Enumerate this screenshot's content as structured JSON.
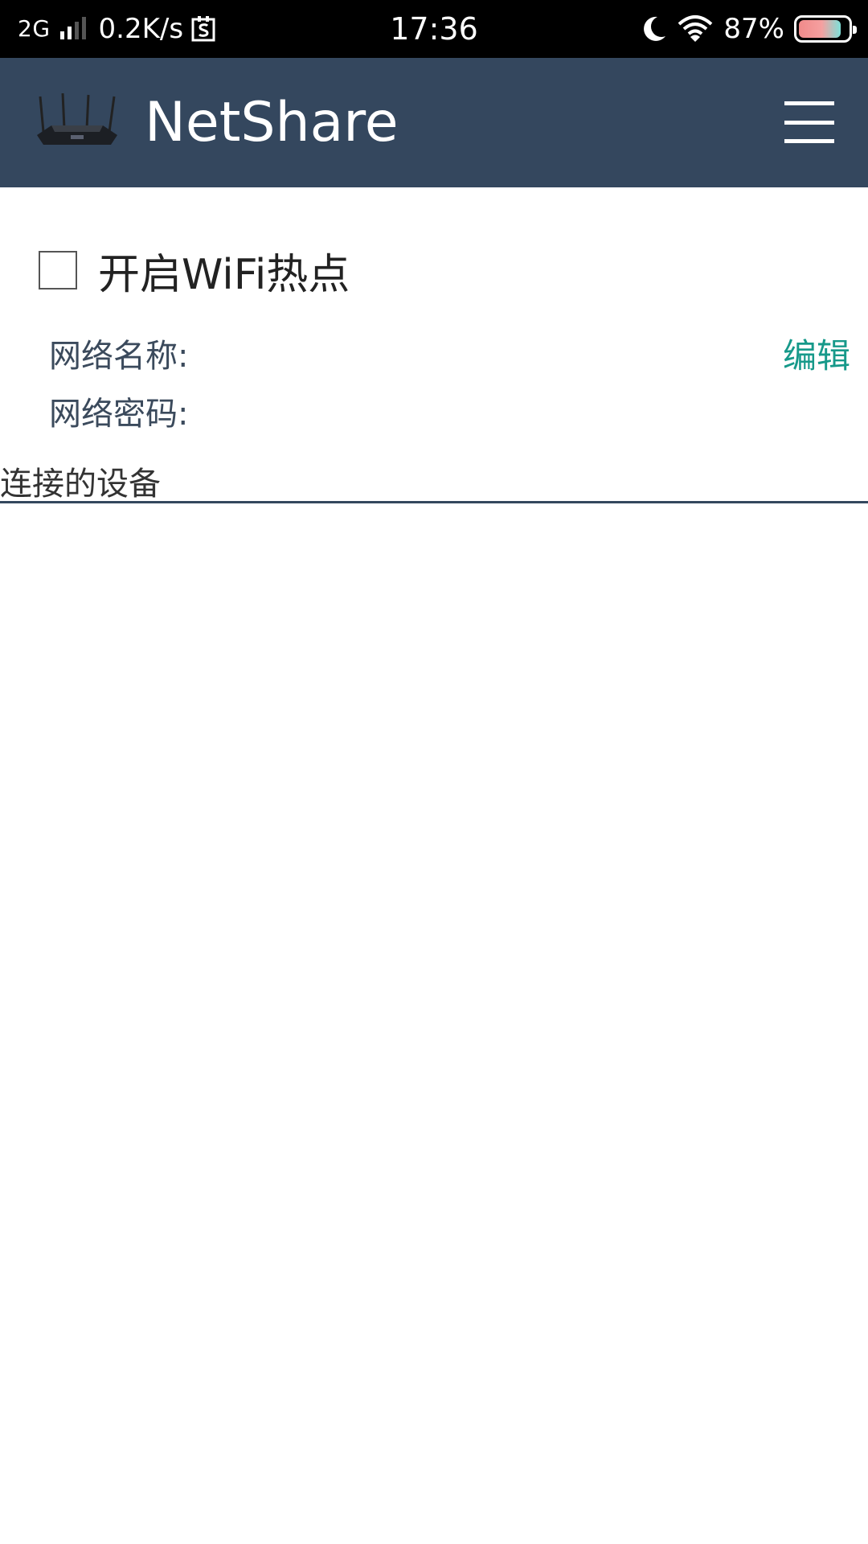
{
  "status_bar": {
    "network": "2G",
    "speed": "0.2K/s",
    "time": "17:36",
    "battery": "87%",
    "battery_level": 0.87
  },
  "app_bar": {
    "title": "NetShare",
    "logo_icon": "router-icon",
    "menu_icon": "hamburger-menu-icon",
    "background": "#34475e"
  },
  "hotspot": {
    "toggle_label": "开启WiFi热点",
    "checked": false
  },
  "network": {
    "name_label": "网络名称:",
    "password_label": "网络密码:",
    "edit_label": "编辑",
    "accent": "#16998a"
  },
  "devices": {
    "header": "连接的设备",
    "items": []
  }
}
